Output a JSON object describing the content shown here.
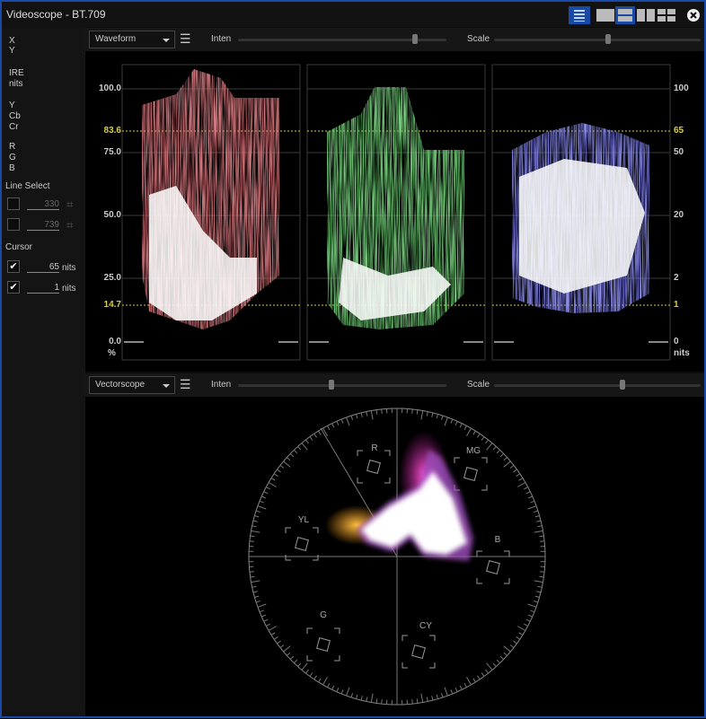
{
  "window": {
    "title": "Videoscope - BT.709"
  },
  "sidebar": {
    "x": "X",
    "y": "Y",
    "ire": "IRE",
    "nits": "nits",
    "ycc": [
      "Y",
      "Cb",
      "Cr"
    ],
    "rgb": [
      "R",
      "G",
      "B"
    ],
    "line_select": {
      "label": "Line Select",
      "lines": [
        {
          "checked": false,
          "value": "330"
        },
        {
          "checked": false,
          "value": "739"
        }
      ]
    },
    "cursor": {
      "label": "Cursor",
      "items": [
        {
          "checked": true,
          "value": "65",
          "unit": "nits"
        },
        {
          "checked": true,
          "value": "1",
          "unit": "nits"
        }
      ]
    }
  },
  "waveform": {
    "mode": "Waveform",
    "inten_label": "Inten",
    "scale_label": "Scale",
    "inten": 0.85,
    "scale": 0.55,
    "left_ticks": [
      "100.0",
      "83.6",
      "75.0",
      "50.0",
      "25.0",
      "14.7",
      "0.0"
    ],
    "left_unit": "%",
    "right_ticks": [
      "100",
      "65",
      "50",
      "20",
      "2",
      "1",
      "0"
    ],
    "right_unit": "nits"
  },
  "vectorscope": {
    "mode": "Vectorscope",
    "inten_label": "Inten",
    "scale_label": "Scale",
    "inten": 0.45,
    "scale": 0.62,
    "targets": [
      "R",
      "MG",
      "B",
      "CY",
      "G",
      "YL"
    ]
  },
  "colors": {
    "accent": "#1a4aa8",
    "cursor": "#d8d040"
  }
}
